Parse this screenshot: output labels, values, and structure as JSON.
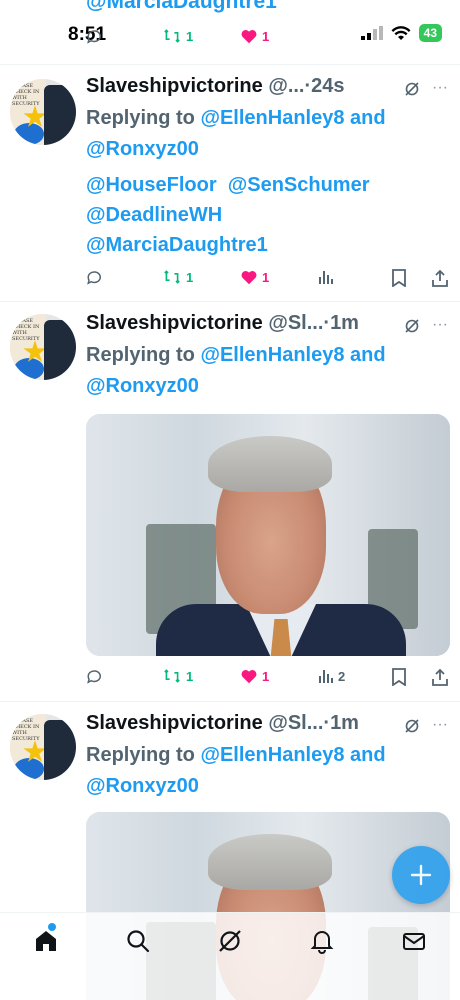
{
  "status_bar": {
    "time": "8:51",
    "battery": "43"
  },
  "top_partial": {
    "mention": "@MarciaDaughtre1",
    "retweets": "1",
    "likes": "1"
  },
  "tweets": [
    {
      "name": "Slaveshipvictorine",
      "handle": "@...",
      "time": "24s",
      "replying_prefix": "Replying to",
      "reply_to_1": "@EllenHanley8",
      "and_word": "and",
      "reply_to_2": "@Ronxyz00",
      "mentions_1": "@HouseFloor  @SenSchumer",
      "mentions_2": "@DeadlineWH",
      "mentions_3": "@MarciaDaughtre1",
      "retweets": "1",
      "likes": "1",
      "views": ""
    },
    {
      "name": "Slaveshipvictorine",
      "handle": "@Sl...",
      "time": "1m",
      "replying_prefix": "Replying to",
      "reply_to_1": "@EllenHanley8",
      "and_word": "and",
      "reply_to_2": "@Ronxyz00",
      "retweets": "1",
      "likes": "1",
      "views": "2"
    },
    {
      "name": "Slaveshipvictorine",
      "handle": "@Sl...",
      "time": "1m",
      "replying_prefix": "Replying to",
      "reply_to_1": "@EllenHanley8",
      "and_word": "and",
      "reply_to_2": "@Ronxyz00"
    }
  ],
  "avatar_text": "PLEASE CHECK IN WITH SECURITY",
  "colors": {
    "accent": "#1d9bf0",
    "retweet": "#00ba7c",
    "like": "#f91880",
    "muted": "#536471",
    "battery": "#34c759"
  },
  "icons": {
    "nav": [
      "home-icon",
      "search-icon",
      "grok-icon",
      "notifications-icon",
      "messages-icon"
    ],
    "fab": "compose-plus-icon"
  }
}
